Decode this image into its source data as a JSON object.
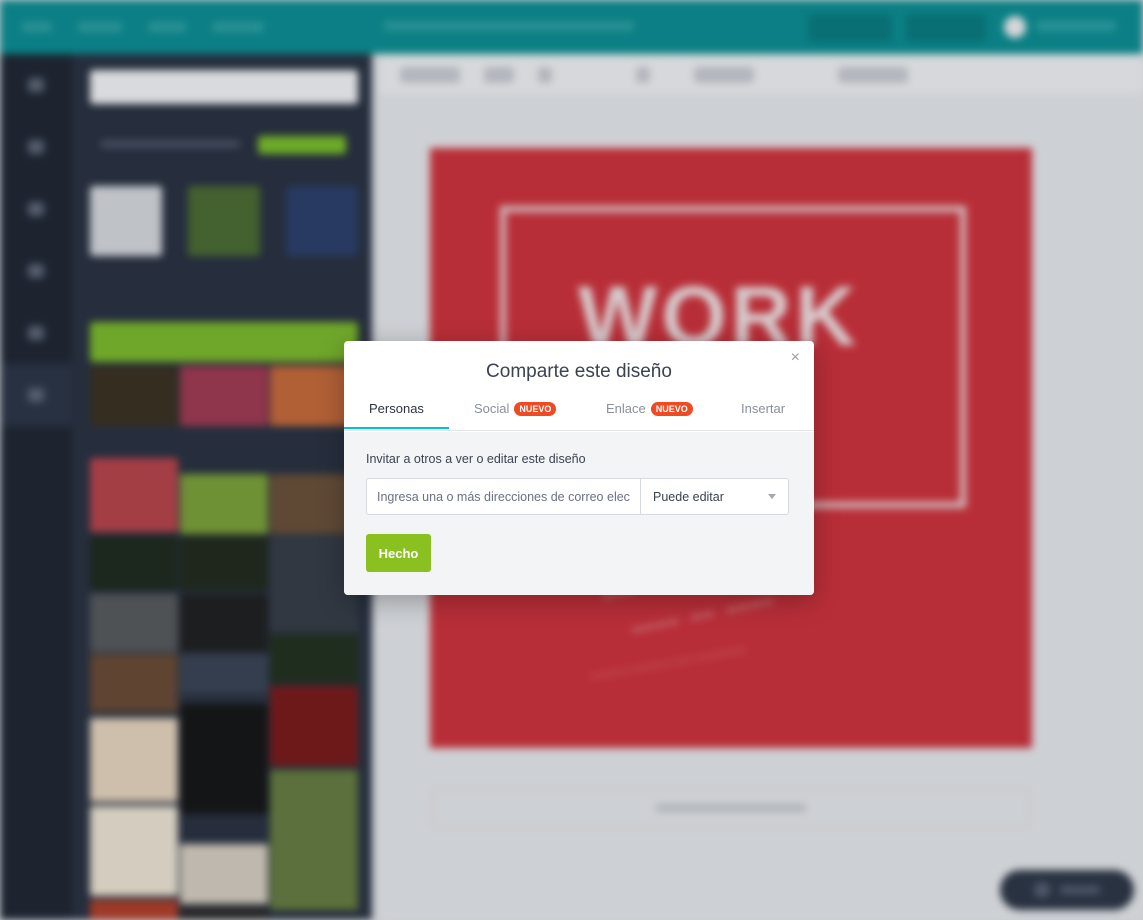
{
  "dialog": {
    "title": "Comparte este diseño",
    "close_glyph": "×",
    "tabs": [
      {
        "label": "Personas",
        "badge": "",
        "active": true
      },
      {
        "label": "Social",
        "badge": "NUEVO",
        "active": false
      },
      {
        "label": "Enlace",
        "badge": "NUEVO",
        "active": false
      },
      {
        "label": "Insertar",
        "badge": "",
        "active": false
      }
    ],
    "invite_label": "Invitar a otros a ver o editar este diseño",
    "email_placeholder": "Ingresa una o más direcciones de correo electrónico",
    "permission_value": "Puede editar",
    "done_label": "Hecho"
  },
  "background": {
    "design_headline": "WORK"
  },
  "colors": {
    "accent_teal": "#00c4cc",
    "topbar_teal": "#0b8e93",
    "done_green": "#8ac121",
    "badge_red": "#ef4a22",
    "design_red": "#d0323c",
    "sidebar_dark": "#293141"
  },
  "icons": {
    "close": "close-icon",
    "select_caret": "chevron-down-icon"
  }
}
